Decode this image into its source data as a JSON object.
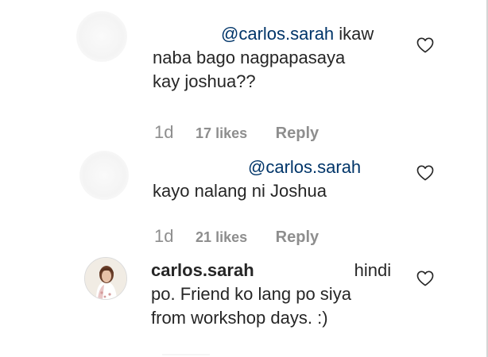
{
  "comments": [
    {
      "mention": "@carlos.sarah",
      "line1_rest": " ikaw",
      "line2": "naba bago nagpapasaya",
      "line3": "kay joshua??",
      "time": "1d",
      "likes": "17 likes",
      "reply": "Reply"
    },
    {
      "mention": "@carlos.sarah",
      "line2": "kayo nalang ni Joshua",
      "time": "1d",
      "likes": "21 likes",
      "reply": "Reply"
    },
    {
      "username": "carlos.sarah",
      "line1_rest": "hindi",
      "line2": "po. Friend ko lang po siya",
      "line3": "from workshop days. :)"
    }
  ],
  "icons": {
    "like": "heart-outline-icon"
  },
  "colors": {
    "text": "#262626",
    "mention": "#003569",
    "meta": "#8e8e8e",
    "heart_stroke": "#262626"
  }
}
